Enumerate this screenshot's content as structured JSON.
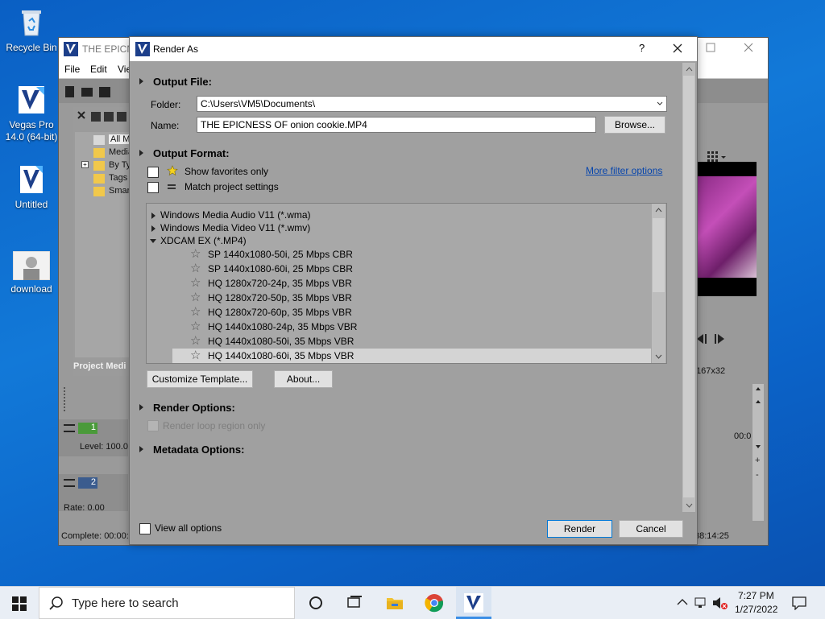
{
  "desktop": {
    "icons": [
      {
        "label": "Recycle Bin"
      },
      {
        "label": "Vegas Pro 14.0 (64-bit)"
      },
      {
        "label": "Untitled"
      },
      {
        "label": "download"
      }
    ]
  },
  "vegas": {
    "title": "THE EPICNE",
    "menu": [
      "File",
      "Edit",
      "Vie"
    ],
    "explorer": [
      "All Me",
      "Media",
      "By Ty",
      "Tags",
      "Smar"
    ],
    "project_media": "Project Medi",
    "track1_number": "1",
    "track2_number": "2",
    "level": "Level: 100.0",
    "rate": "Rate: 0.00",
    "complete": "Complete: 00:00:",
    "resolution": "167x32",
    "timecode": "38:14:25",
    "ruler": "00:0"
  },
  "dialog": {
    "title": "Render As",
    "help": "?",
    "output_file": {
      "heading": "Output File:",
      "folder_label": "Folder:",
      "folder_value": "C:\\Users\\VM5\\Documents\\",
      "name_label": "Name:",
      "name_value": "THE EPICNESS OF onion cookie.MP4",
      "browse": "Browse..."
    },
    "output_format": {
      "heading": "Output Format:",
      "show_favorites": "Show favorites only",
      "match_project": "Match project settings",
      "filter_link": "More filter options",
      "categories": [
        "Windows Media Audio V11 (*.wma)",
        "Windows Media Video V11 (*.wmv)",
        "XDCAM EX (*.MP4)"
      ],
      "templates": [
        "SP 1440x1080-50i, 25 Mbps CBR",
        "SP 1440x1080-60i, 25 Mbps CBR",
        "HQ 1280x720-24p, 35 Mbps VBR",
        "HQ 1280x720-50p, 35 Mbps VBR",
        "HQ 1280x720-60p, 35 Mbps VBR",
        "HQ 1440x1080-24p, 35 Mbps VBR",
        "HQ 1440x1080-50i, 35 Mbps VBR",
        "HQ 1440x1080-60i, 35 Mbps VBR"
      ],
      "selected_template": "HQ 1440x1080-60i, 35 Mbps VBR",
      "customize": "Customize Template...",
      "about": "About..."
    },
    "render_options": {
      "heading": "Render Options:",
      "loop_region": "Render loop region only"
    },
    "metadata_options": {
      "heading": "Metadata Options:"
    },
    "view_all": "View all options",
    "render": "Render",
    "cancel": "Cancel"
  },
  "taskbar": {
    "search_placeholder": "Type here to search",
    "time": "7:27 PM",
    "date": "1/27/2022"
  }
}
